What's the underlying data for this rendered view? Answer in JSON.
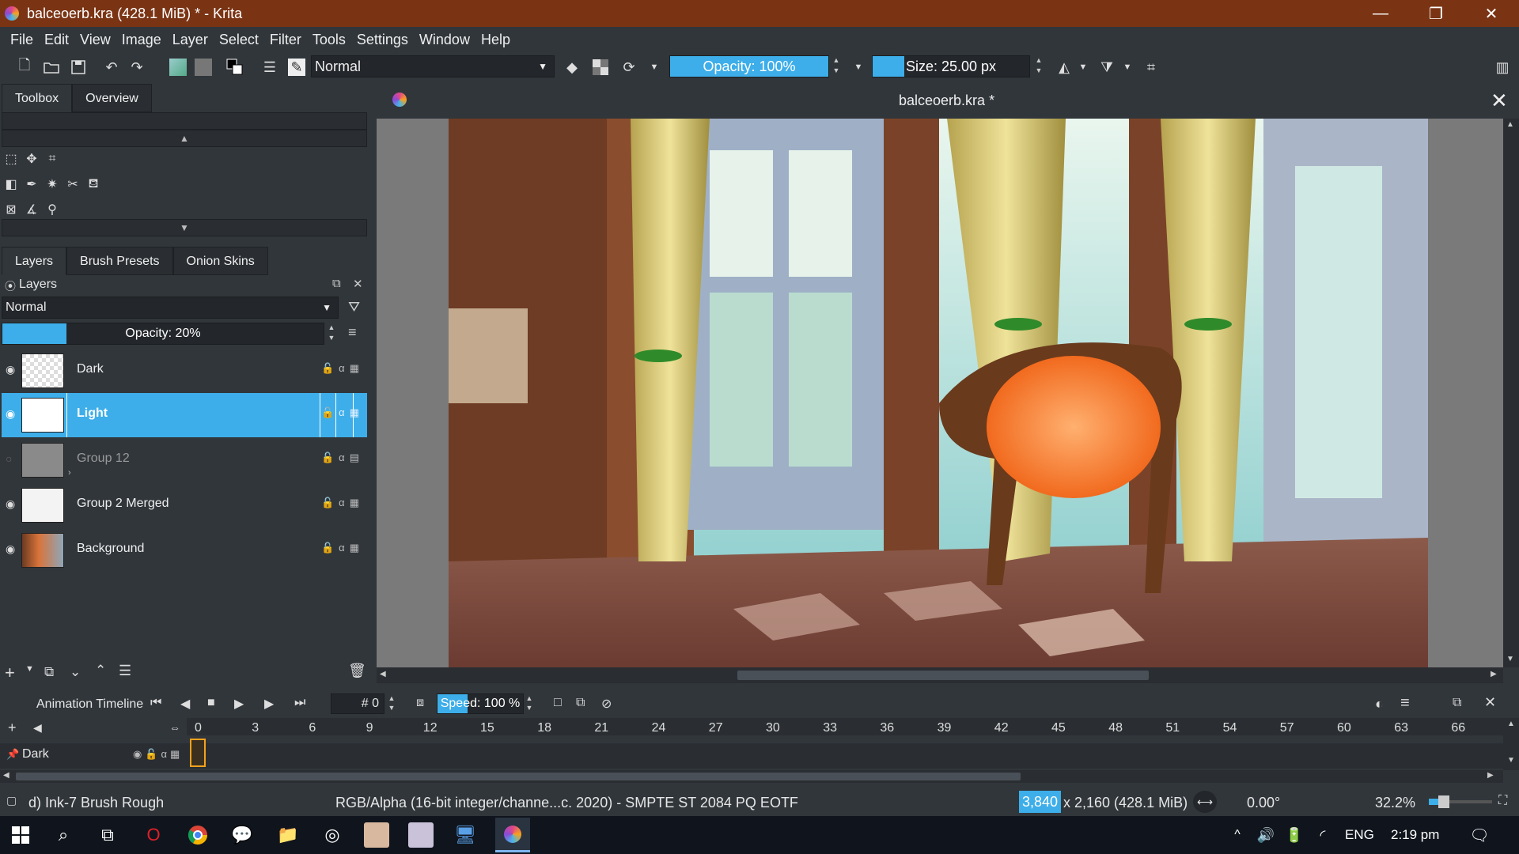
{
  "window": {
    "title": "balceoerb.kra (428.1 MiB)  * - Krita",
    "minimize": "—",
    "maximize": "❐",
    "close": "✕"
  },
  "menu": [
    "File",
    "Edit",
    "View",
    "Image",
    "Layer",
    "Select",
    "Filter",
    "Tools",
    "Settings",
    "Window",
    "Help"
  ],
  "toolbar": {
    "blend_mode": "Normal",
    "opacity_label": "Opacity: 100%",
    "opacity_value": 1.0,
    "size_label": "Size: 25.00 px",
    "size_fill_fraction": 0.2
  },
  "left_tabs": {
    "toolbox": "Toolbox",
    "overview": "Overview"
  },
  "docker_tabs": {
    "layers": "Layers",
    "brush_presets": "Brush Presets",
    "onion_skins": "Onion Skins"
  },
  "layers_panel": {
    "title": "Layers",
    "blend_mode": "Normal",
    "opacity_label": "Opacity:  20%",
    "opacity_value": 0.2,
    "layers": [
      {
        "name": "Dark",
        "visible": true,
        "selected": false
      },
      {
        "name": "Light",
        "visible": true,
        "selected": true
      },
      {
        "name": "Group 12",
        "visible": false,
        "selected": false
      },
      {
        "name": "Group 2 Merged",
        "visible": true,
        "selected": false
      },
      {
        "name": "Background",
        "visible": true,
        "selected": false
      }
    ]
  },
  "canvas": {
    "doc_title": "balceoerb.kra *",
    "close": "✕"
  },
  "timeline": {
    "title": "Animation Timeline",
    "frame_field": "# 0",
    "speed_label": "Speed: 100 %",
    "speed_value": 1.0,
    "frames": [
      "0",
      "3",
      "6",
      "9",
      "12",
      "15",
      "18",
      "21",
      "24",
      "27",
      "30",
      "33",
      "36",
      "39",
      "42",
      "45",
      "48",
      "51",
      "54",
      "57",
      "60",
      "63",
      "66"
    ],
    "track_layer": "Dark"
  },
  "status": {
    "brush": "d) Ink-7 Brush Rough",
    "color_space": "RGB/Alpha (16-bit integer/channe...c. 2020) - SMPTE ST 2084 PQ EOTF",
    "width": "3,840",
    "dims_rest": "x 2,160 (428.1 MiB)",
    "rotation": "0.00°",
    "zoom": "32.2%"
  },
  "taskbar": {
    "language": "ENG",
    "time": "2:19 pm"
  },
  "colors": {
    "titlebar": "#7a3414",
    "panel": "#31363b",
    "accent": "#3daee9",
    "taskbar": "#10151d"
  }
}
